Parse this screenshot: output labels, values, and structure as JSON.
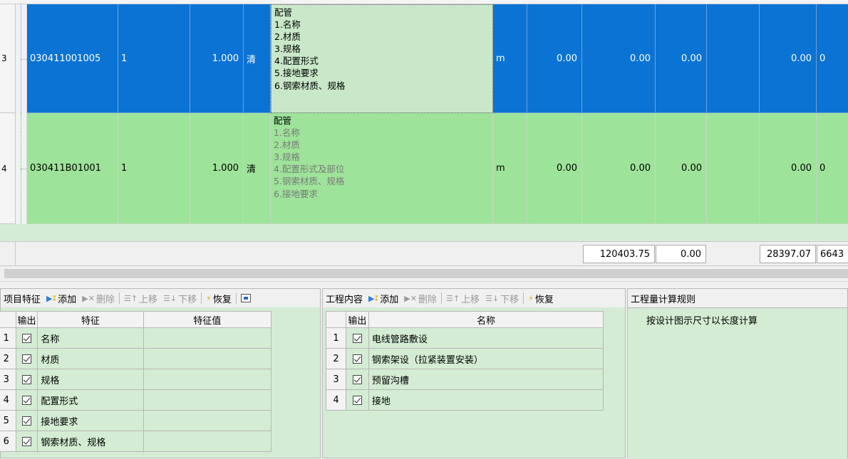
{
  "grid": {
    "rows": [
      {
        "row_label": "3",
        "code": "030411001005",
        "no": "1",
        "qty": "1.000",
        "type": "清",
        "desc": [
          "配管",
          "1.名称",
          "2.材质",
          "3.规格",
          "4.配置形式",
          "5.接地要求",
          "6.钢索材质、规格"
        ],
        "unit": "m",
        "v1": "0.00",
        "v2": "0.00",
        "v3": "0.00",
        "v4": "",
        "v5": "0.00",
        "v6": "0"
      },
      {
        "row_label": "4",
        "code": "030411B01001",
        "no": "1",
        "qty": "1.000",
        "type": "清",
        "desc": [
          "配管",
          "1.名称",
          "2.材质",
          "3.规格",
          "4.配置形式及部位",
          "5.钢索材质、规格",
          "6.接地要求"
        ],
        "unit": "m",
        "v1": "0.00",
        "v2": "0.00",
        "v3": "0.00",
        "v4": "",
        "v5": "0.00",
        "v6": "0"
      }
    ]
  },
  "totals": {
    "t1": "120403.75",
    "t2": "0.00",
    "t3": "28397.07",
    "t4": "6643"
  },
  "features_panel": {
    "title": "项目特征",
    "add": "添加",
    "delete": "删除",
    "up": "上移",
    "down": "下移",
    "restore": "恢复",
    "col_output": "输出",
    "col_feature": "特征",
    "col_value": "特征值",
    "rows": [
      {
        "n": "1",
        "name": "名称",
        "value": ""
      },
      {
        "n": "2",
        "name": "材质",
        "value": ""
      },
      {
        "n": "3",
        "name": "规格",
        "value": ""
      },
      {
        "n": "4",
        "name": "配置形式",
        "value": ""
      },
      {
        "n": "5",
        "name": "接地要求",
        "value": ""
      },
      {
        "n": "6",
        "name": "钢索材质、规格",
        "value": ""
      }
    ]
  },
  "content_panel": {
    "title": "工程内容",
    "add": "添加",
    "delete": "删除",
    "up": "上移",
    "down": "下移",
    "restore": "恢复",
    "col_output": "输出",
    "col_name": "名称",
    "rows": [
      {
        "n": "1",
        "name": "电线管路敷设"
      },
      {
        "n": "2",
        "name": "钢索架设（拉紧装置安装）"
      },
      {
        "n": "3",
        "name": "预留沟槽"
      },
      {
        "n": "4",
        "name": "接地"
      }
    ]
  },
  "rules_panel": {
    "title": "工程量计算规则",
    "text": "按设计图示尺寸以长度计算"
  },
  "colors": {
    "selected_row": "#0b73d4",
    "green_row": "#9ee39a",
    "panel_bg": "#d4ecd4"
  }
}
